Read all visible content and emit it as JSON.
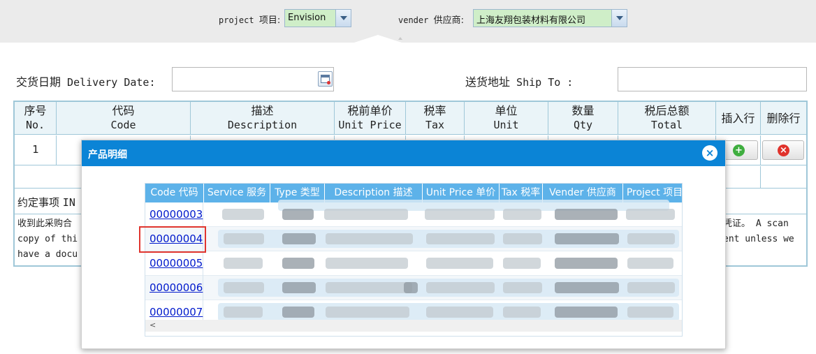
{
  "topbar": {
    "project_label": "project",
    "project_label_cn": "项目:",
    "project_value": "Envision",
    "vender_label": "vender",
    "vender_label_cn": "供应商:",
    "vender_value": "上海友翔包装材料有限公司"
  },
  "delivery": {
    "date_label_cn": "交货日期",
    "date_label": "Delivery Date:",
    "date_value": "",
    "ship_label_cn": "送货地址",
    "ship_label": "Ship To :",
    "ship_value": ""
  },
  "order_table": {
    "columns": [
      {
        "cn": "序号",
        "en": "No."
      },
      {
        "cn": "代码",
        "en": "Code"
      },
      {
        "cn": "描述",
        "en": "Description"
      },
      {
        "cn": "税前单价",
        "en": "Unit Price"
      },
      {
        "cn": "税率",
        "en": "Tax"
      },
      {
        "cn": "单位",
        "en": "Unit"
      },
      {
        "cn": "数量",
        "en": "Qty"
      },
      {
        "cn": "税后总额",
        "en": "Total"
      },
      {
        "cn": "插入行",
        "en": ""
      },
      {
        "cn": "删除行",
        "en": ""
      }
    ],
    "rows": [
      {
        "no": "1"
      }
    ],
    "add_icon": "plus-circle-icon",
    "delete_icon": "x-circle-icon"
  },
  "terms": {
    "title_cn": "约定事项",
    "title_en": "IN",
    "line1_left": "收到此采购合",
    "line1_right": "凭证。 A scan",
    "line2_left": "copy of thi",
    "line2_right": "ent unless we",
    "line3_left": "have a docu"
  },
  "modal": {
    "title": "产品明细",
    "close_icon": "close-icon",
    "columns": [
      "Code 代码",
      "Service 服务",
      "Type 类型",
      "Description 描述",
      "Unit Price 单价",
      "Tax 税率",
      "Vender 供应商",
      "Project 项目"
    ],
    "rows": [
      {
        "code": "00000003"
      },
      {
        "code": "00000004"
      },
      {
        "code": "00000005"
      },
      {
        "code": "00000006"
      },
      {
        "code": "00000007"
      }
    ],
    "scroll_up": "˄",
    "scroll_down": "˅",
    "scroll_left": "<",
    "scroll_right": ">"
  },
  "colors": {
    "modal_header": "#0b84d6",
    "grid_header": "#5db2e9",
    "select_bg": "#cfeec8",
    "highlight": "#e0352e",
    "link": "#0019cc"
  }
}
